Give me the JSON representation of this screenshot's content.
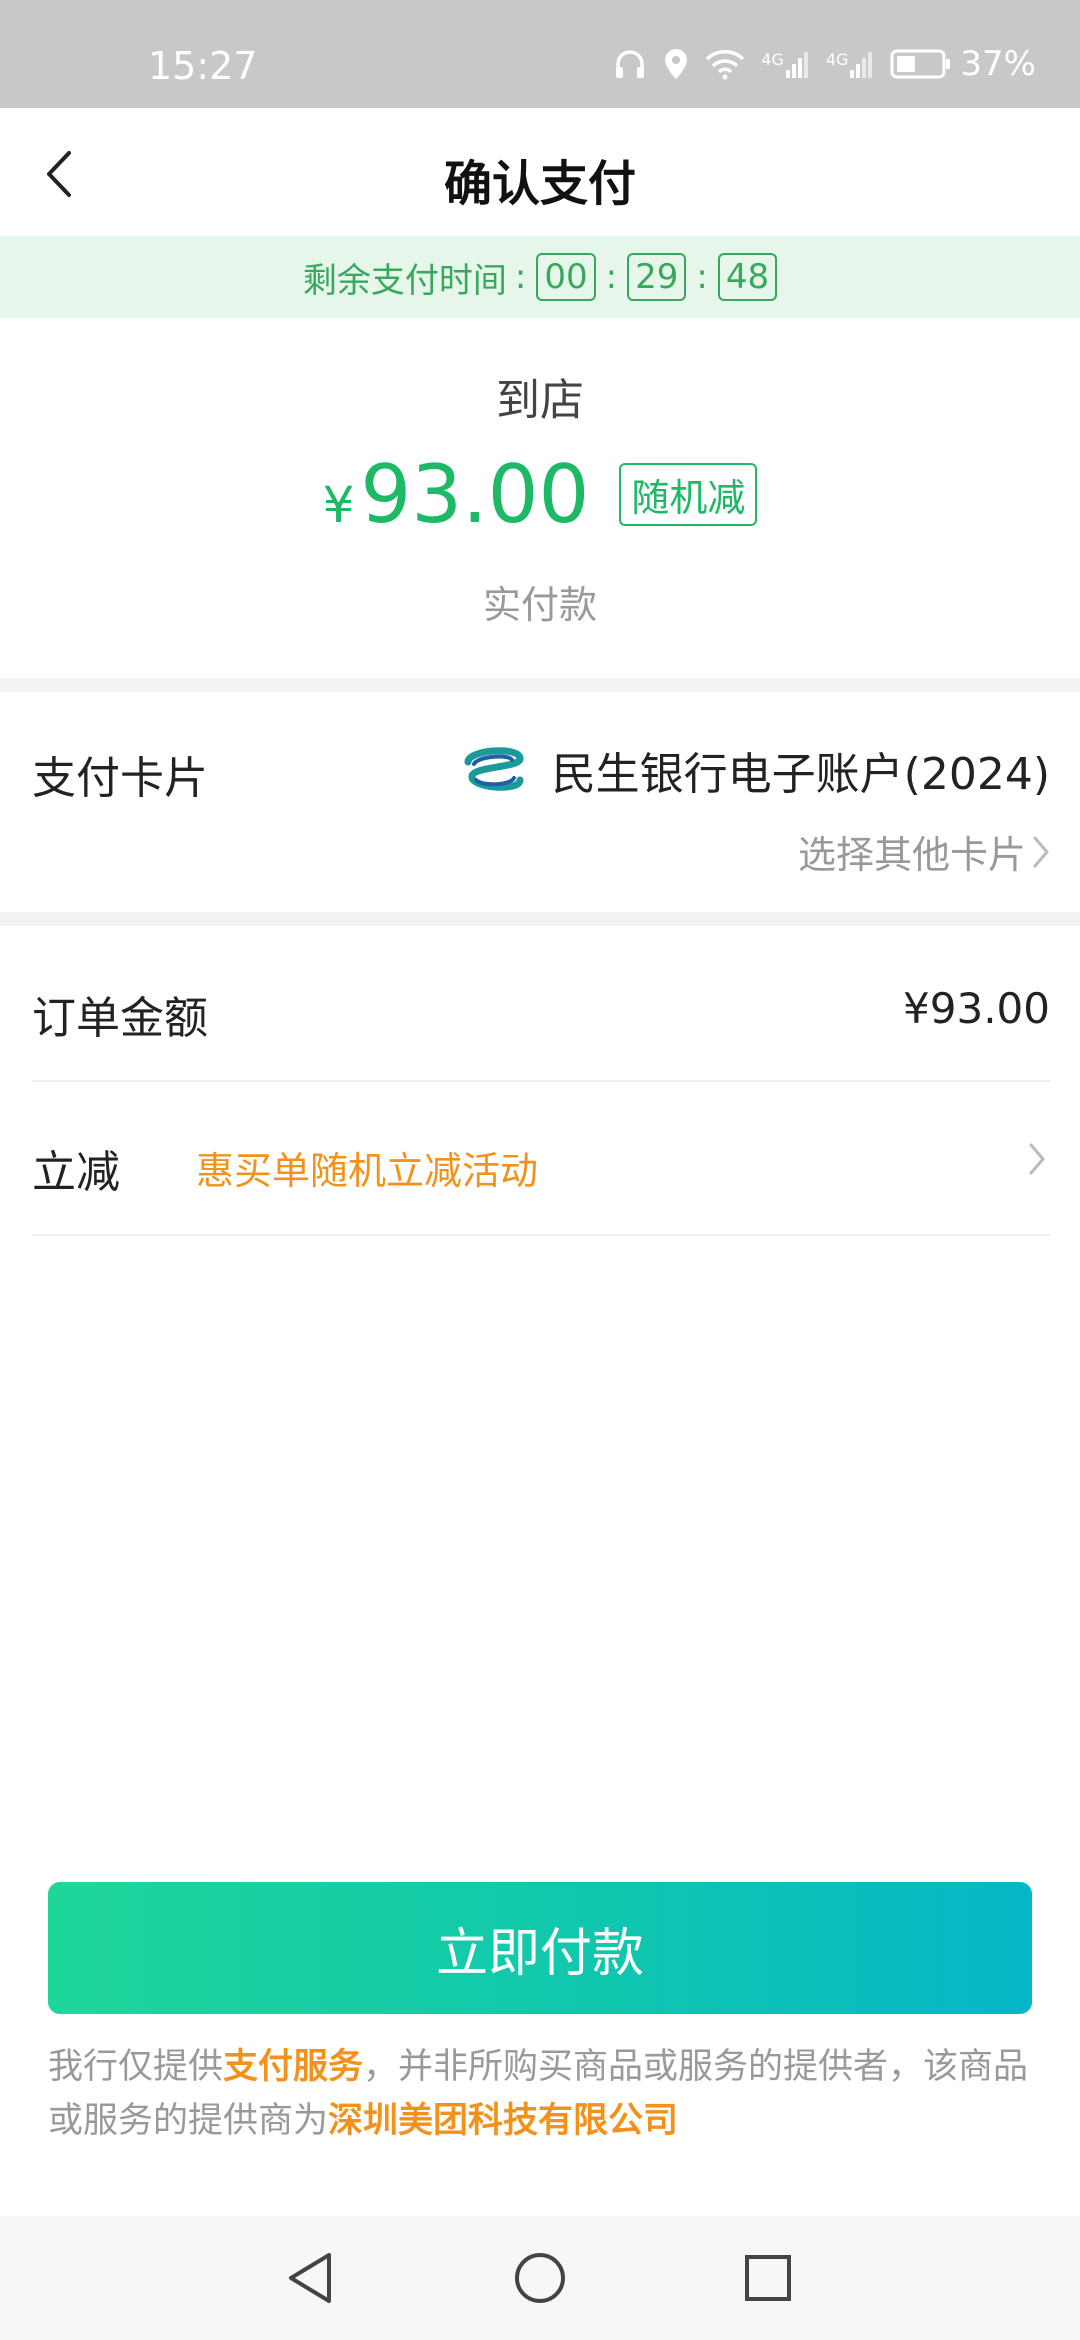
{
  "status_bar": {
    "time": "15:27",
    "network_1": "4G",
    "network_2": "4G",
    "battery_percent": "37%"
  },
  "header": {
    "title": "确认支付",
    "back_icon": "chevron-left-icon"
  },
  "countdown": {
    "label": "剩余支付时间",
    "colon": ":",
    "hours": "00",
    "minutes": "29",
    "seconds": "48"
  },
  "payment": {
    "merchant": "到店",
    "currency_symbol": "¥",
    "amount": "93.00",
    "badge": "随机减",
    "amount_label": "实付款"
  },
  "card": {
    "label": "支付卡片",
    "bank_name": "民生银行电子账户(2024)",
    "choose_other": "选择其他卡片"
  },
  "order": {
    "amount_label": "订单金额",
    "amount_value": "¥93.00",
    "discount_label": "立减",
    "discount_activity": "惠买单随机立减活动"
  },
  "pay_button": {
    "label": "立即付款"
  },
  "disclaimer": {
    "part1": "我行仅提供",
    "highlight1": "支付服务",
    "part2": "，并非所购买商品或服务的提供者，该商品或服务的提供商为",
    "highlight2": "深圳美团科技有限公司"
  },
  "colors": {
    "accent_green": "#1db966",
    "countdown_bg": "#e6f6ea",
    "promo_orange": "#f3921a",
    "button_gradient_start": "#1fd69a",
    "button_gradient_end": "#05b7c8"
  }
}
